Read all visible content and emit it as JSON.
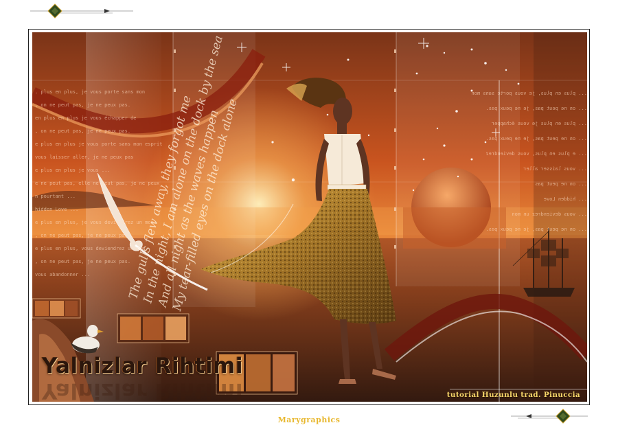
{
  "artwork": {
    "poem_lines": [
      "The gulls flew away, they forgot me",
      "In the night, I am alone on the dock by the sea",
      "And all night as the waves happen",
      "My tear-filled eyes on the dock alone"
    ],
    "title": "Yalnizlar Rihtimi",
    "credit": "tutorial Huzunlu trad. Pinuccia",
    "background_text_left": [
      ". plus en plus, je vous porte sans mon",
      ", on ne peut pas, je ne peux pas.",
      "en plus en plus je vous échapper de",
      ", on ne peut pas, je ne peux pas.",
      "e plus en plus je vous porte sans mon esprit",
      "vous laisser aller, je ne peux pas",
      "e plus en plus je vous ...",
      "e ne peut pas, elle ne peut pas, je ne peux",
      "n pourtant ...",
      "hidden Love ...",
      "e plus en plus, je vous deviendrez un mon",
      ", on ne peut pas, je ne peux pas.",
      "e plus en plus, vous deviendrez un mon",
      ", on ne peut pas, je ne peux pas.",
      "vous abandonner ..."
    ],
    "background_text_right": [
      "... plus en plus, je vous porte sans mon",
      "... on ne peut pas, je ne peux pas.",
      "... plus en plus je vous échapper",
      "... on ne peut pas, je ne peux pas.",
      "... e plus en plus, vous deviendrez",
      "... vous laisser aller",
      "... on ne peut pas",
      "... hidden Love",
      "... vous deviendrez un mon",
      "... on ne peut pas, je ne peux pas."
    ]
  },
  "footer": {
    "signature": "Marygraphics"
  },
  "colors": {
    "sky_top": "#7a3418",
    "sky_mid": "#d9682a",
    "glow": "#f7b25a",
    "sea": "#5a2e1c",
    "accent_gold": "#e8b830",
    "deco_green": "#2f4a1e"
  }
}
